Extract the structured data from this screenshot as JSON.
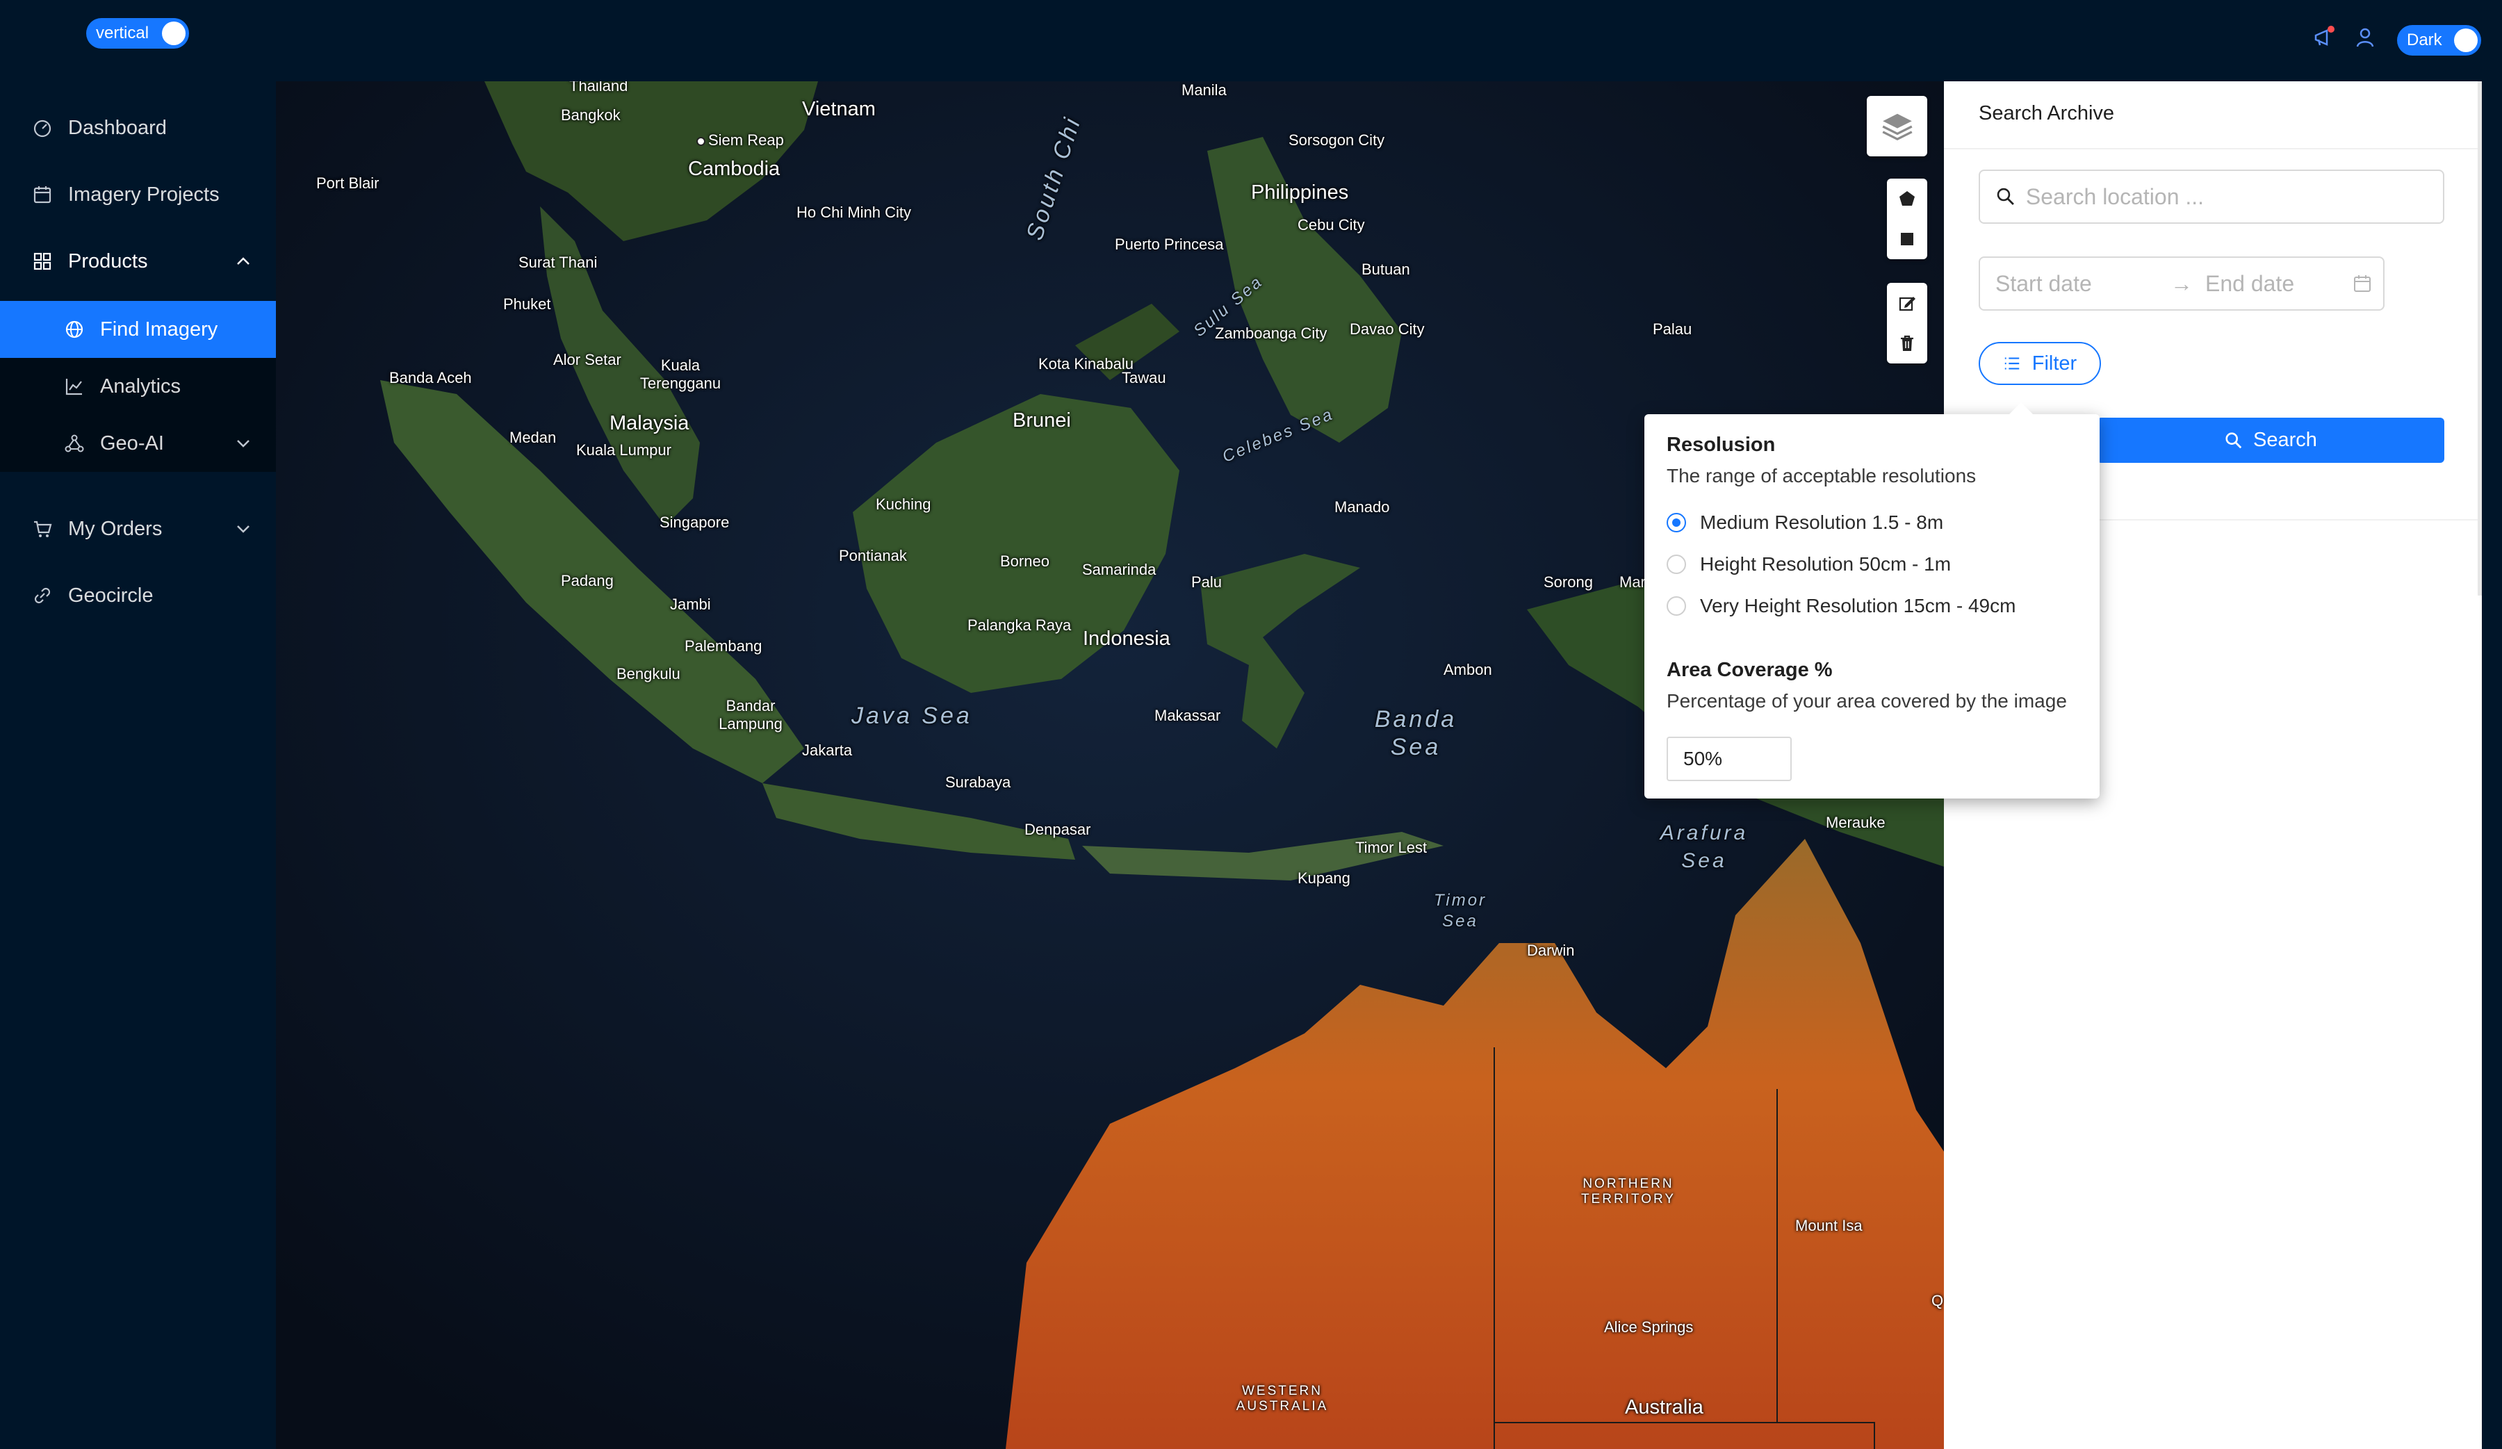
{
  "header": {
    "layout_toggle_label": "vertical",
    "theme_toggle_label": "Dark"
  },
  "sidebar": {
    "items": [
      {
        "label": "Dashboard"
      },
      {
        "label": "Imagery Projects"
      },
      {
        "label": "Products"
      },
      {
        "label": "Find Imagery"
      },
      {
        "label": "Analytics"
      },
      {
        "label": "Geo-AI"
      },
      {
        "label": "My Orders"
      },
      {
        "label": "Geocircle"
      }
    ]
  },
  "map": {
    "labels": [
      {
        "id": "thailand",
        "text": "Thailand"
      },
      {
        "id": "bangkok",
        "text": "Bangkok"
      },
      {
        "id": "vietnam",
        "text": "Vietnam"
      },
      {
        "id": "siem_reap",
        "text": "Siem Reap"
      },
      {
        "id": "cambodia",
        "text": "Cambodia"
      },
      {
        "id": "port_blair",
        "text": "Port Blair"
      },
      {
        "id": "ho_chi_minh",
        "text": "Ho Chi Minh City"
      },
      {
        "id": "south_china",
        "text": "South Chi"
      },
      {
        "id": "manila",
        "text": "Manila"
      },
      {
        "id": "sorsogon",
        "text": "Sorsogon City"
      },
      {
        "id": "philippines",
        "text": "Philippines"
      },
      {
        "id": "cebu",
        "text": "Cebu City"
      },
      {
        "id": "puerto_princesa",
        "text": "Puerto Princesa"
      },
      {
        "id": "butuan",
        "text": "Butuan"
      },
      {
        "id": "surat_thani",
        "text": "Surat Thani"
      },
      {
        "id": "phuket",
        "text": "Phuket"
      },
      {
        "id": "sulu_sea",
        "text": "Sulu Sea"
      },
      {
        "id": "zamboanga",
        "text": "Zamboanga City"
      },
      {
        "id": "davao",
        "text": "Davao City"
      },
      {
        "id": "palau",
        "text": "Palau"
      },
      {
        "id": "banda_aceh",
        "text": "Banda Aceh"
      },
      {
        "id": "alor_setar",
        "text": "Alor Setar"
      },
      {
        "id": "kuala_terengganu",
        "text": "Kuala Terengganu"
      },
      {
        "id": "kota_kinabalu",
        "text": "Kota Kinabalu"
      },
      {
        "id": "medan",
        "text": "Medan"
      },
      {
        "id": "malaysia",
        "text": "Malaysia"
      },
      {
        "id": "kuala_lumpur",
        "text": "Kuala Lumpur"
      },
      {
        "id": "brunei",
        "text": "Brunei"
      },
      {
        "id": "tawau",
        "text": "Tawau"
      },
      {
        "id": "celebes_sea",
        "text": "Celebes Sea"
      },
      {
        "id": "singapore",
        "text": "Singapore"
      },
      {
        "id": "kuching",
        "text": "Kuching"
      },
      {
        "id": "manado",
        "text": "Manado"
      },
      {
        "id": "pontianak",
        "text": "Pontianak"
      },
      {
        "id": "borneo",
        "text": "Borneo"
      },
      {
        "id": "samarinda",
        "text": "Samarinda"
      },
      {
        "id": "padang",
        "text": "Padang"
      },
      {
        "id": "palu",
        "text": "Palu"
      },
      {
        "id": "sorong",
        "text": "Sorong"
      },
      {
        "id": "mar",
        "text": "Mar"
      },
      {
        "id": "jambi",
        "text": "Jambi"
      },
      {
        "id": "palangka_raya",
        "text": "Palangka Raya"
      },
      {
        "id": "indonesia",
        "text": "Indonesia"
      },
      {
        "id": "palembang",
        "text": "Palembang"
      },
      {
        "id": "bengkulu",
        "text": "Bengkulu"
      },
      {
        "id": "ambon",
        "text": "Ambon"
      },
      {
        "id": "bandar_lampung",
        "text": "Bandar Lampung"
      },
      {
        "id": "makassar",
        "text": "Makassar"
      },
      {
        "id": "java_sea",
        "text": "Java Sea"
      },
      {
        "id": "banda_sea",
        "text": "Banda Sea"
      },
      {
        "id": "jakarta",
        "text": "Jakarta"
      },
      {
        "id": "surabaya",
        "text": "Surabaya"
      },
      {
        "id": "denpasar",
        "text": "Denpasar"
      },
      {
        "id": "arafura_sea",
        "text": "Arafura Sea"
      },
      {
        "id": "merauke",
        "text": "Merauke"
      },
      {
        "id": "timor_leste",
        "text": "Timor Lest"
      },
      {
        "id": "kupang",
        "text": "Kupang"
      },
      {
        "id": "timor_sea",
        "text": "Timor Sea"
      },
      {
        "id": "darwin",
        "text": "Darwin"
      },
      {
        "id": "northern_territory",
        "text": "NORTHERN TERRITORY"
      },
      {
        "id": "mount_isa",
        "text": "Mount Isa"
      },
      {
        "id": "alice_springs",
        "text": "Alice Springs"
      },
      {
        "id": "western_australia",
        "text": "WESTERN AUSTRALIA"
      },
      {
        "id": "australia",
        "text": "Australia"
      },
      {
        "id": "q",
        "text": "Q"
      }
    ]
  },
  "panel": {
    "title": "Search Archive",
    "search_placeholder": "Search location ...",
    "start_date_placeholder": "Start date",
    "end_date_placeholder": "End date",
    "filter_label": "Filter",
    "search_label": "Search"
  },
  "filter_popover": {
    "resolution_title": "Resolusion",
    "resolution_desc": "The range of acceptable resolutions",
    "options": [
      {
        "label": "Medium Resolution 1.5 - 8m",
        "selected": true
      },
      {
        "label": "Height Resolution 50cm - 1m",
        "selected": false
      },
      {
        "label": "Very Height Resolution 15cm - 49cm",
        "selected": false
      }
    ],
    "coverage_title": "Area Coverage %",
    "coverage_desc": "Percentage of your area covered by the image",
    "coverage_value": "50%"
  },
  "colors": {
    "primary": "#1677ff",
    "sidebar_bg": "#001529",
    "submenu_bg": "#000c17"
  }
}
